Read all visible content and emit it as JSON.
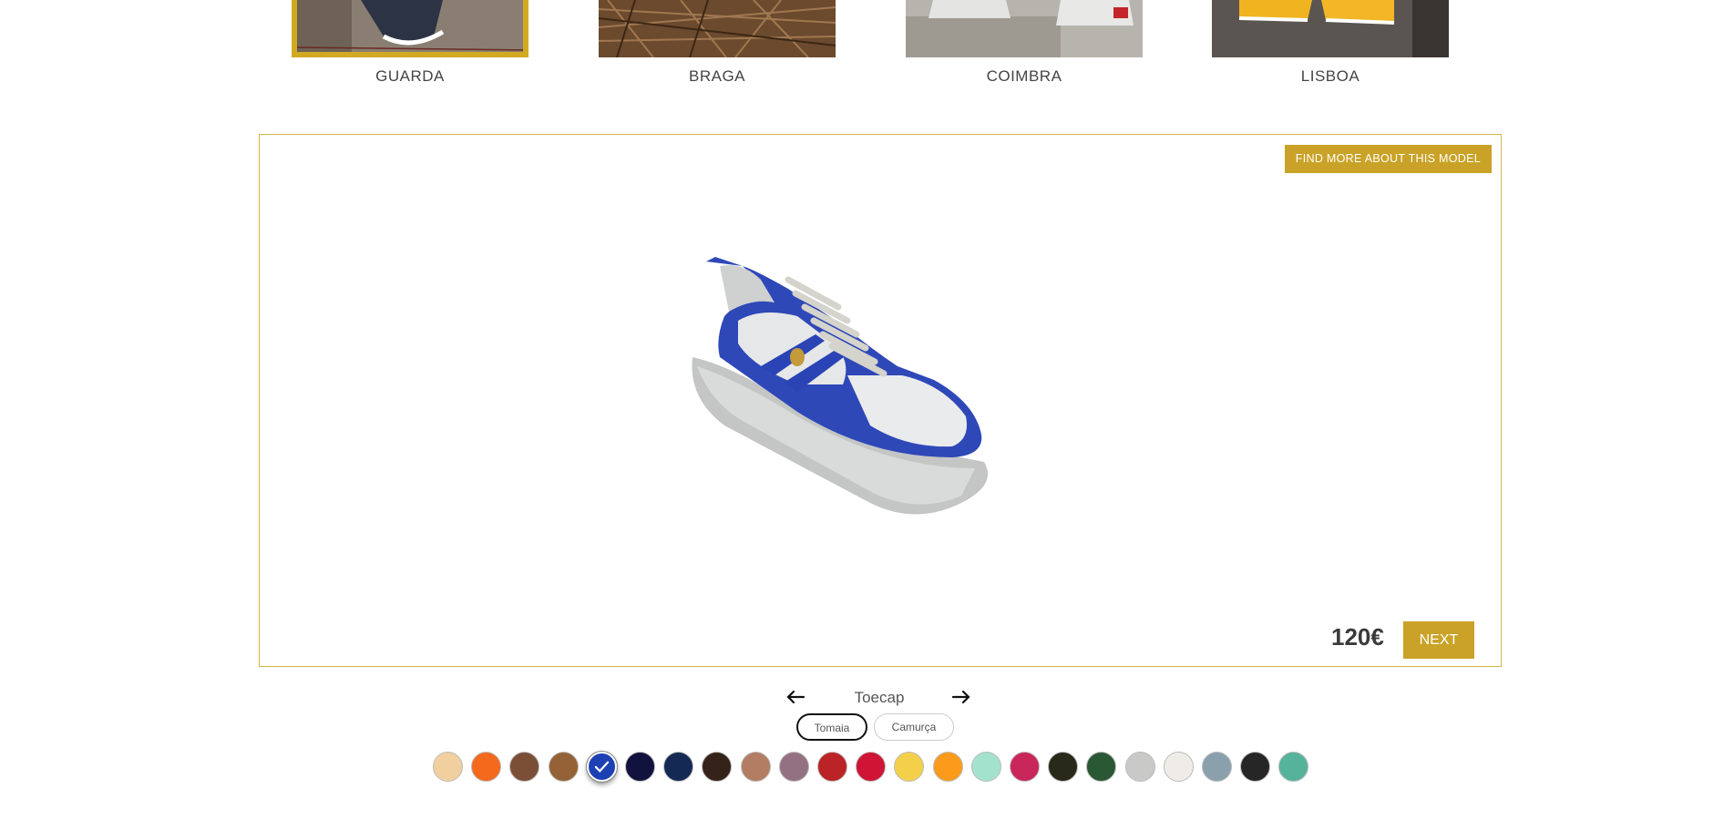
{
  "models": [
    {
      "name": "GUARDA",
      "selected": true
    },
    {
      "name": "BRAGA",
      "selected": false
    },
    {
      "name": "COIMBRA",
      "selected": false
    },
    {
      "name": "LISBOA",
      "selected": false
    }
  ],
  "stage": {
    "find_more_label": "FIND MORE ABOUT THIS MODEL",
    "price": "120€",
    "next_label": "NEXT"
  },
  "part_nav": {
    "current_part": "Toecap",
    "prev_icon": "arrow-left-icon",
    "next_icon": "arrow-right-icon"
  },
  "materials": [
    {
      "label": "Tomaia",
      "selected": true
    },
    {
      "label": "Camurça",
      "selected": false
    }
  ],
  "swatches": [
    {
      "color": "#f2cf9f",
      "selected": false
    },
    {
      "color": "#f5691d",
      "selected": false
    },
    {
      "color": "#7a4f35",
      "selected": false
    },
    {
      "color": "#946236",
      "selected": false
    },
    {
      "color": "#1e40b5",
      "selected": true
    },
    {
      "color": "#12123e",
      "selected": false
    },
    {
      "color": "#142a54",
      "selected": false
    },
    {
      "color": "#35231a",
      "selected": false
    },
    {
      "color": "#b27d62",
      "selected": false
    },
    {
      "color": "#947182",
      "selected": false
    },
    {
      "color": "#bb2326",
      "selected": false
    },
    {
      "color": "#cf1435",
      "selected": false
    },
    {
      "color": "#f4d04a",
      "selected": false
    },
    {
      "color": "#fb9a1b",
      "selected": false
    },
    {
      "color": "#a3e2cc",
      "selected": false
    },
    {
      "color": "#c9265a",
      "selected": false
    },
    {
      "color": "#29291a",
      "selected": false
    },
    {
      "color": "#2a5834",
      "selected": false
    },
    {
      "color": "#c9c9c7",
      "selected": false
    },
    {
      "color": "#efece8",
      "selected": false
    },
    {
      "color": "#8aa0ad",
      "selected": false
    },
    {
      "color": "#262626",
      "selected": false
    },
    {
      "color": "#56b39b",
      "selected": false
    }
  ],
  "colors": {
    "accent": "#c9a227",
    "stage_border": "#d4b547"
  }
}
